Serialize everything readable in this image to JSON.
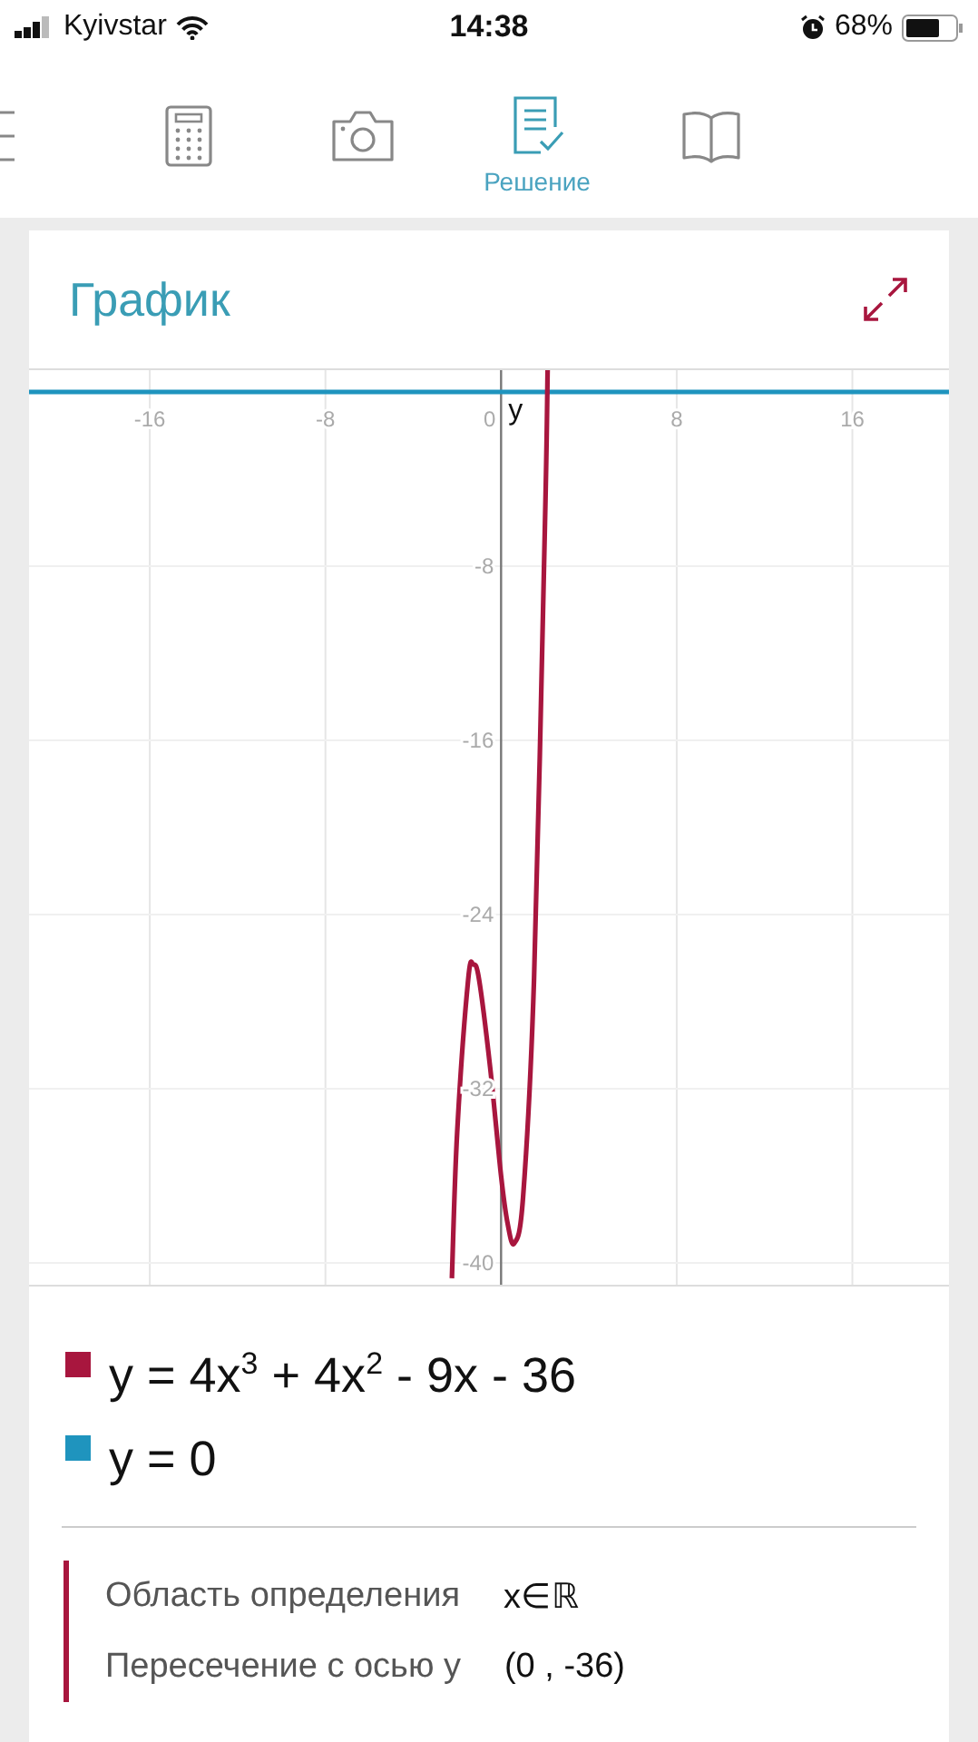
{
  "status_bar": {
    "carrier": "Kyivstar",
    "time": "14:38",
    "battery": "68%"
  },
  "tabs": [
    {
      "selected": false
    },
    {
      "selected": false
    },
    {
      "selected": false
    },
    {
      "label": "Решение",
      "selected": true
    },
    {
      "selected": false
    }
  ],
  "card": {
    "title": "График",
    "chart_data": {
      "type": "line",
      "ylabel": "y",
      "grid": true,
      "x": [
        -21.5,
        -2.24,
        -2,
        -1.5,
        -1.26,
        -1,
        -0.5,
        0,
        0.3,
        0.6,
        1,
        1.5,
        2,
        2.12,
        20.4
      ],
      "series": [
        {
          "name": "y = 4x$^{3}$ + 4x$^{2}$ - 9x - 36",
          "color": "#a8163e",
          "values": [
            null,
            -40.7,
            -34,
            -27,
            -26.3,
            -27,
            -31,
            -36,
            -38.2,
            -39.1,
            -37,
            -27,
            -6,
            1,
            null
          ]
        },
        {
          "name": "y = 0",
          "color": "#1f94be",
          "values": [
            0,
            0,
            0,
            0,
            0,
            0,
            0,
            0,
            0,
            0,
            0,
            0,
            0,
            0,
            0
          ]
        }
      ],
      "xlim": [
        -21.5,
        20.4
      ],
      "ylim": [
        -41,
        1
      ],
      "xticks": [
        -16,
        -8,
        0,
        8,
        16
      ],
      "yticks": [
        -8,
        -16,
        -24,
        -32,
        -40
      ]
    },
    "properties": [
      {
        "label": "Область определения",
        "value": "x∈ℝ"
      },
      {
        "label": "Пересечение с осью у",
        "value": "(0 , -36)"
      }
    ]
  }
}
